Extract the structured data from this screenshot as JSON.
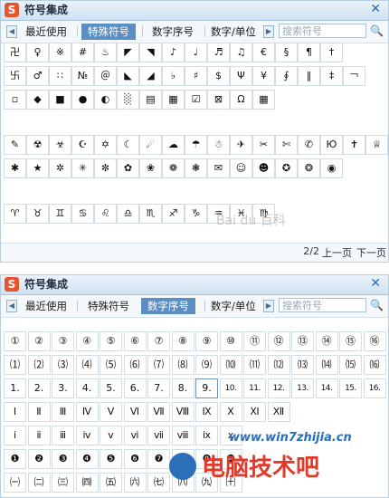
{
  "panels": [
    {
      "title": "符号集成",
      "tabs": [
        "最近使用",
        "特殊符号",
        "数字序号",
        "数字/单位"
      ],
      "active_tab": 1,
      "search_placeholder": "搜索符号",
      "grid_groups": [
        [
          [
            "卍",
            "♀",
            "※",
            "#",
            "♨",
            "◤",
            "◥",
            "♪",
            "♩",
            "♬",
            "♫",
            "€",
            "§",
            "¶",
            "†"
          ],
          [
            "卐",
            "♂",
            "∷",
            "№",
            "＠",
            "◣",
            "◢",
            "♭",
            "♯",
            "$",
            "Ψ",
            "¥",
            "∮",
            "‖",
            "‡",
            "￢"
          ],
          [
            "▫",
            "◆",
            "■",
            "●",
            "◐",
            "░",
            "▤",
            "▦",
            "☑",
            "⊠",
            "Ω",
            "▦"
          ]
        ],
        [
          [
            "✎",
            "☢",
            "☣",
            "☪",
            "✡",
            "☾",
            "☄",
            "☁",
            "☂",
            "☃",
            "✈",
            "✂",
            "✄",
            "✆",
            "Ю",
            "✝",
            "♕"
          ],
          [
            "✱",
            "★",
            "✲",
            "✳",
            "✼",
            "✿",
            "❀",
            "❁",
            "❃",
            "✉",
            "☺",
            "☻",
            "✪",
            "❂",
            "◉"
          ]
        ],
        [
          [
            "♈",
            "♉",
            "♊",
            "♋",
            "♌",
            "♎",
            "♏",
            "♐",
            "♑",
            "♒",
            "♓",
            "♍"
          ]
        ]
      ],
      "page_no": "2/2",
      "prev_label": "上一页",
      "next_label": "下一页"
    },
    {
      "title": "符号集成",
      "tabs": [
        "最近使用",
        "特殊符号",
        "数字序号",
        "数字/单位"
      ],
      "active_tab": 2,
      "search_placeholder": "搜索符号",
      "rows": [
        [
          "①",
          "②",
          "③",
          "④",
          "⑤",
          "⑥",
          "⑦",
          "⑧",
          "⑨",
          "⑩",
          "⑪",
          "⑫",
          "⑬",
          "⑭",
          "⑮",
          "⑯"
        ],
        [
          "⑴",
          "⑵",
          "⑶",
          "⑷",
          "⑸",
          "⑹",
          "⑺",
          "⑻",
          "⑼",
          "⑽",
          "⑾",
          "⑿",
          "⒀",
          "⒁",
          "⒂",
          "⒃"
        ],
        [
          "1.",
          "2.",
          "3.",
          "4.",
          "5.",
          "6.",
          "7.",
          "8.",
          "9.",
          "10.",
          "11.",
          "12.",
          "13.",
          "14.",
          "15.",
          "16."
        ],
        [
          "Ⅰ",
          "Ⅱ",
          "Ⅲ",
          "Ⅳ",
          "Ⅴ",
          "Ⅵ",
          "Ⅶ",
          "Ⅷ",
          "Ⅸ",
          "Ⅹ",
          "Ⅺ",
          "Ⅻ"
        ],
        [
          "ⅰ",
          "ⅱ",
          "ⅲ",
          "ⅳ",
          "ⅴ",
          "ⅵ",
          "ⅶ",
          "ⅷ",
          "ⅸ",
          "ⅹ"
        ],
        [
          "❶",
          "❷",
          "❸",
          "❹",
          "❺",
          "❻",
          "❼",
          "❽",
          "❾",
          "❿"
        ],
        [
          "㈠",
          "㈡",
          "㈢",
          "㈣",
          "㈤",
          "㈥",
          "㈦",
          "㈧",
          "㈨",
          "㈩"
        ]
      ],
      "selected_cell": [
        2,
        8
      ]
    }
  ],
  "watermarks": {
    "baidu_text": "Bai du 百科",
    "site_url": "www.win7zhijia.cn",
    "site_brand": "电脑技术吧"
  },
  "icons": {
    "close": "close-icon",
    "search": "search-icon",
    "left": "arrow-left-icon",
    "right": "arrow-right-icon",
    "logo": "sogou-s-logo"
  },
  "colors": {
    "active_tab": "#5b8fc4",
    "logo": "#e8542b",
    "title_bar": "#cfe1f2"
  }
}
